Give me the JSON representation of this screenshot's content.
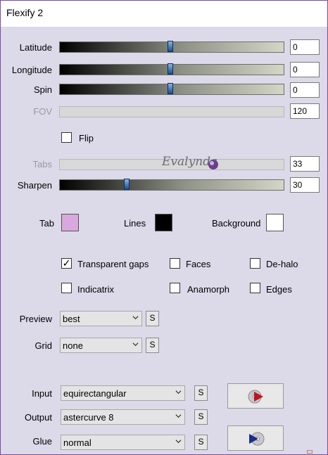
{
  "window": {
    "title": "Flexify 2"
  },
  "sliders": [
    {
      "label": "Latitude",
      "value": "0",
      "level": 0.49,
      "enabled": true
    },
    {
      "label": "Longitude",
      "value": "0",
      "level": 0.49,
      "enabled": true
    },
    {
      "label": "Spin",
      "value": "0",
      "level": 0.49,
      "enabled": true
    },
    {
      "label": "FOV",
      "value": "120",
      "level": null,
      "enabled": false
    },
    {
      "label": "Tabs",
      "value": "33",
      "level": null,
      "enabled": false
    },
    {
      "label": "Sharpen",
      "value": "30",
      "level": 0.3,
      "enabled": true
    }
  ],
  "flip": {
    "label": "Flip",
    "checked": false
  },
  "watermark": "Evalynda",
  "colors": {
    "tab": {
      "label": "Tab",
      "hex": "#d9a8dc"
    },
    "lines": {
      "label": "Lines",
      "hex": "#000000"
    },
    "background": {
      "label": "Background",
      "hex": "#ffffff"
    }
  },
  "options": {
    "transparent_gaps": {
      "label": "Transparent gaps",
      "checked": true
    },
    "faces": {
      "label": "Faces",
      "checked": false
    },
    "de_halo": {
      "label": "De-halo",
      "checked": false
    },
    "indicatrix": {
      "label": "Indicatrix",
      "checked": false
    },
    "anamorph": {
      "label": "Anamorph",
      "checked": false
    },
    "edges": {
      "label": "Edges",
      "checked": false
    }
  },
  "preview": {
    "label": "Preview",
    "value": "best"
  },
  "grid": {
    "label": "Grid",
    "value": "none"
  },
  "input": {
    "label": "Input",
    "value": "equirectangular"
  },
  "output": {
    "label": "Output",
    "value": "astercurve 8"
  },
  "glue": {
    "label": "Glue",
    "value": "normal"
  },
  "s_button_label": "S",
  "icons": {
    "convert_forward": "play-disc-icon",
    "convert_back": "reverse-disc-icon",
    "dropdown": "chevron-down-icon"
  }
}
